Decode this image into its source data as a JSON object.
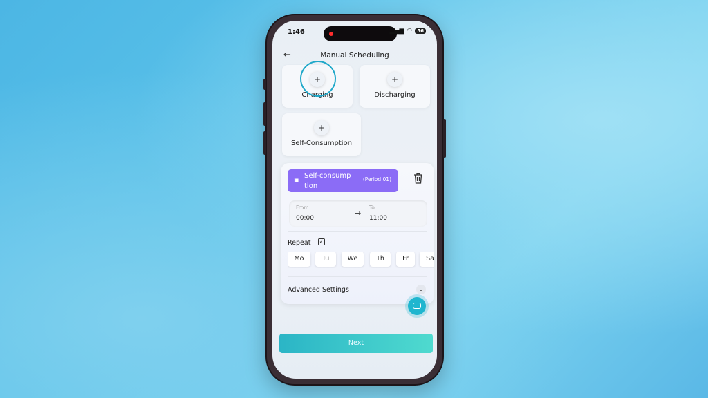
{
  "status_bar": {
    "time": "1:46",
    "battery": "56"
  },
  "header": {
    "title": "Manual Scheduling"
  },
  "modes": [
    {
      "label": "Charging"
    },
    {
      "label": "Discharging"
    },
    {
      "label": "Self-Consumption"
    }
  ],
  "period": {
    "name": "Self-consumption",
    "period_label": "(Period 01)",
    "from_label": "From",
    "from_value": "00:00",
    "to_label": "To",
    "to_value": "11:00",
    "repeat_label": "Repeat",
    "days": [
      "Mo",
      "Tu",
      "We",
      "Th",
      "Fr",
      "Sa"
    ],
    "advanced_label": "Advanced Settings"
  },
  "next_label": "Next",
  "colors": {
    "accent": "#8b6cf6",
    "primary": "#2bb5c6",
    "highlight_ring": "#1fa8c9"
  }
}
